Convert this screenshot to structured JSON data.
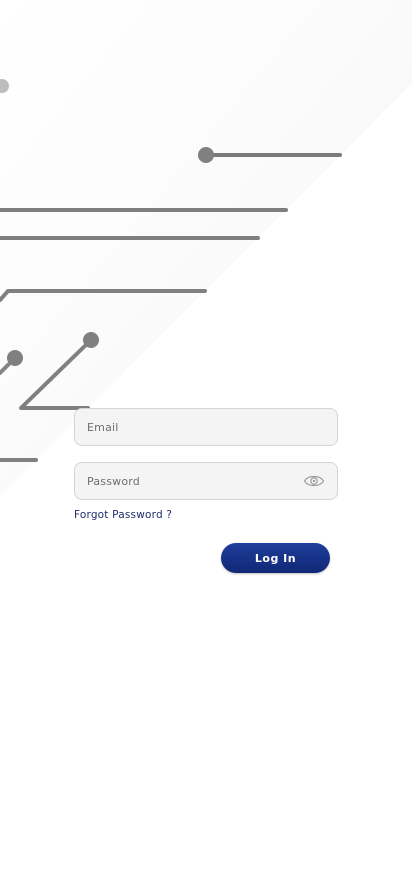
{
  "login": {
    "email_placeholder": "Email",
    "password_placeholder": "Password",
    "forgot_password_label": "Forgot Password ?",
    "login_button_label": "Log In"
  },
  "icons": {
    "password_toggle": "eye-icon"
  },
  "colors": {
    "button_primary": "#1a3a95",
    "link": "#1f2d6b",
    "field_background": "#f4f4f4",
    "circuit_lines": "#8a8a8a"
  }
}
